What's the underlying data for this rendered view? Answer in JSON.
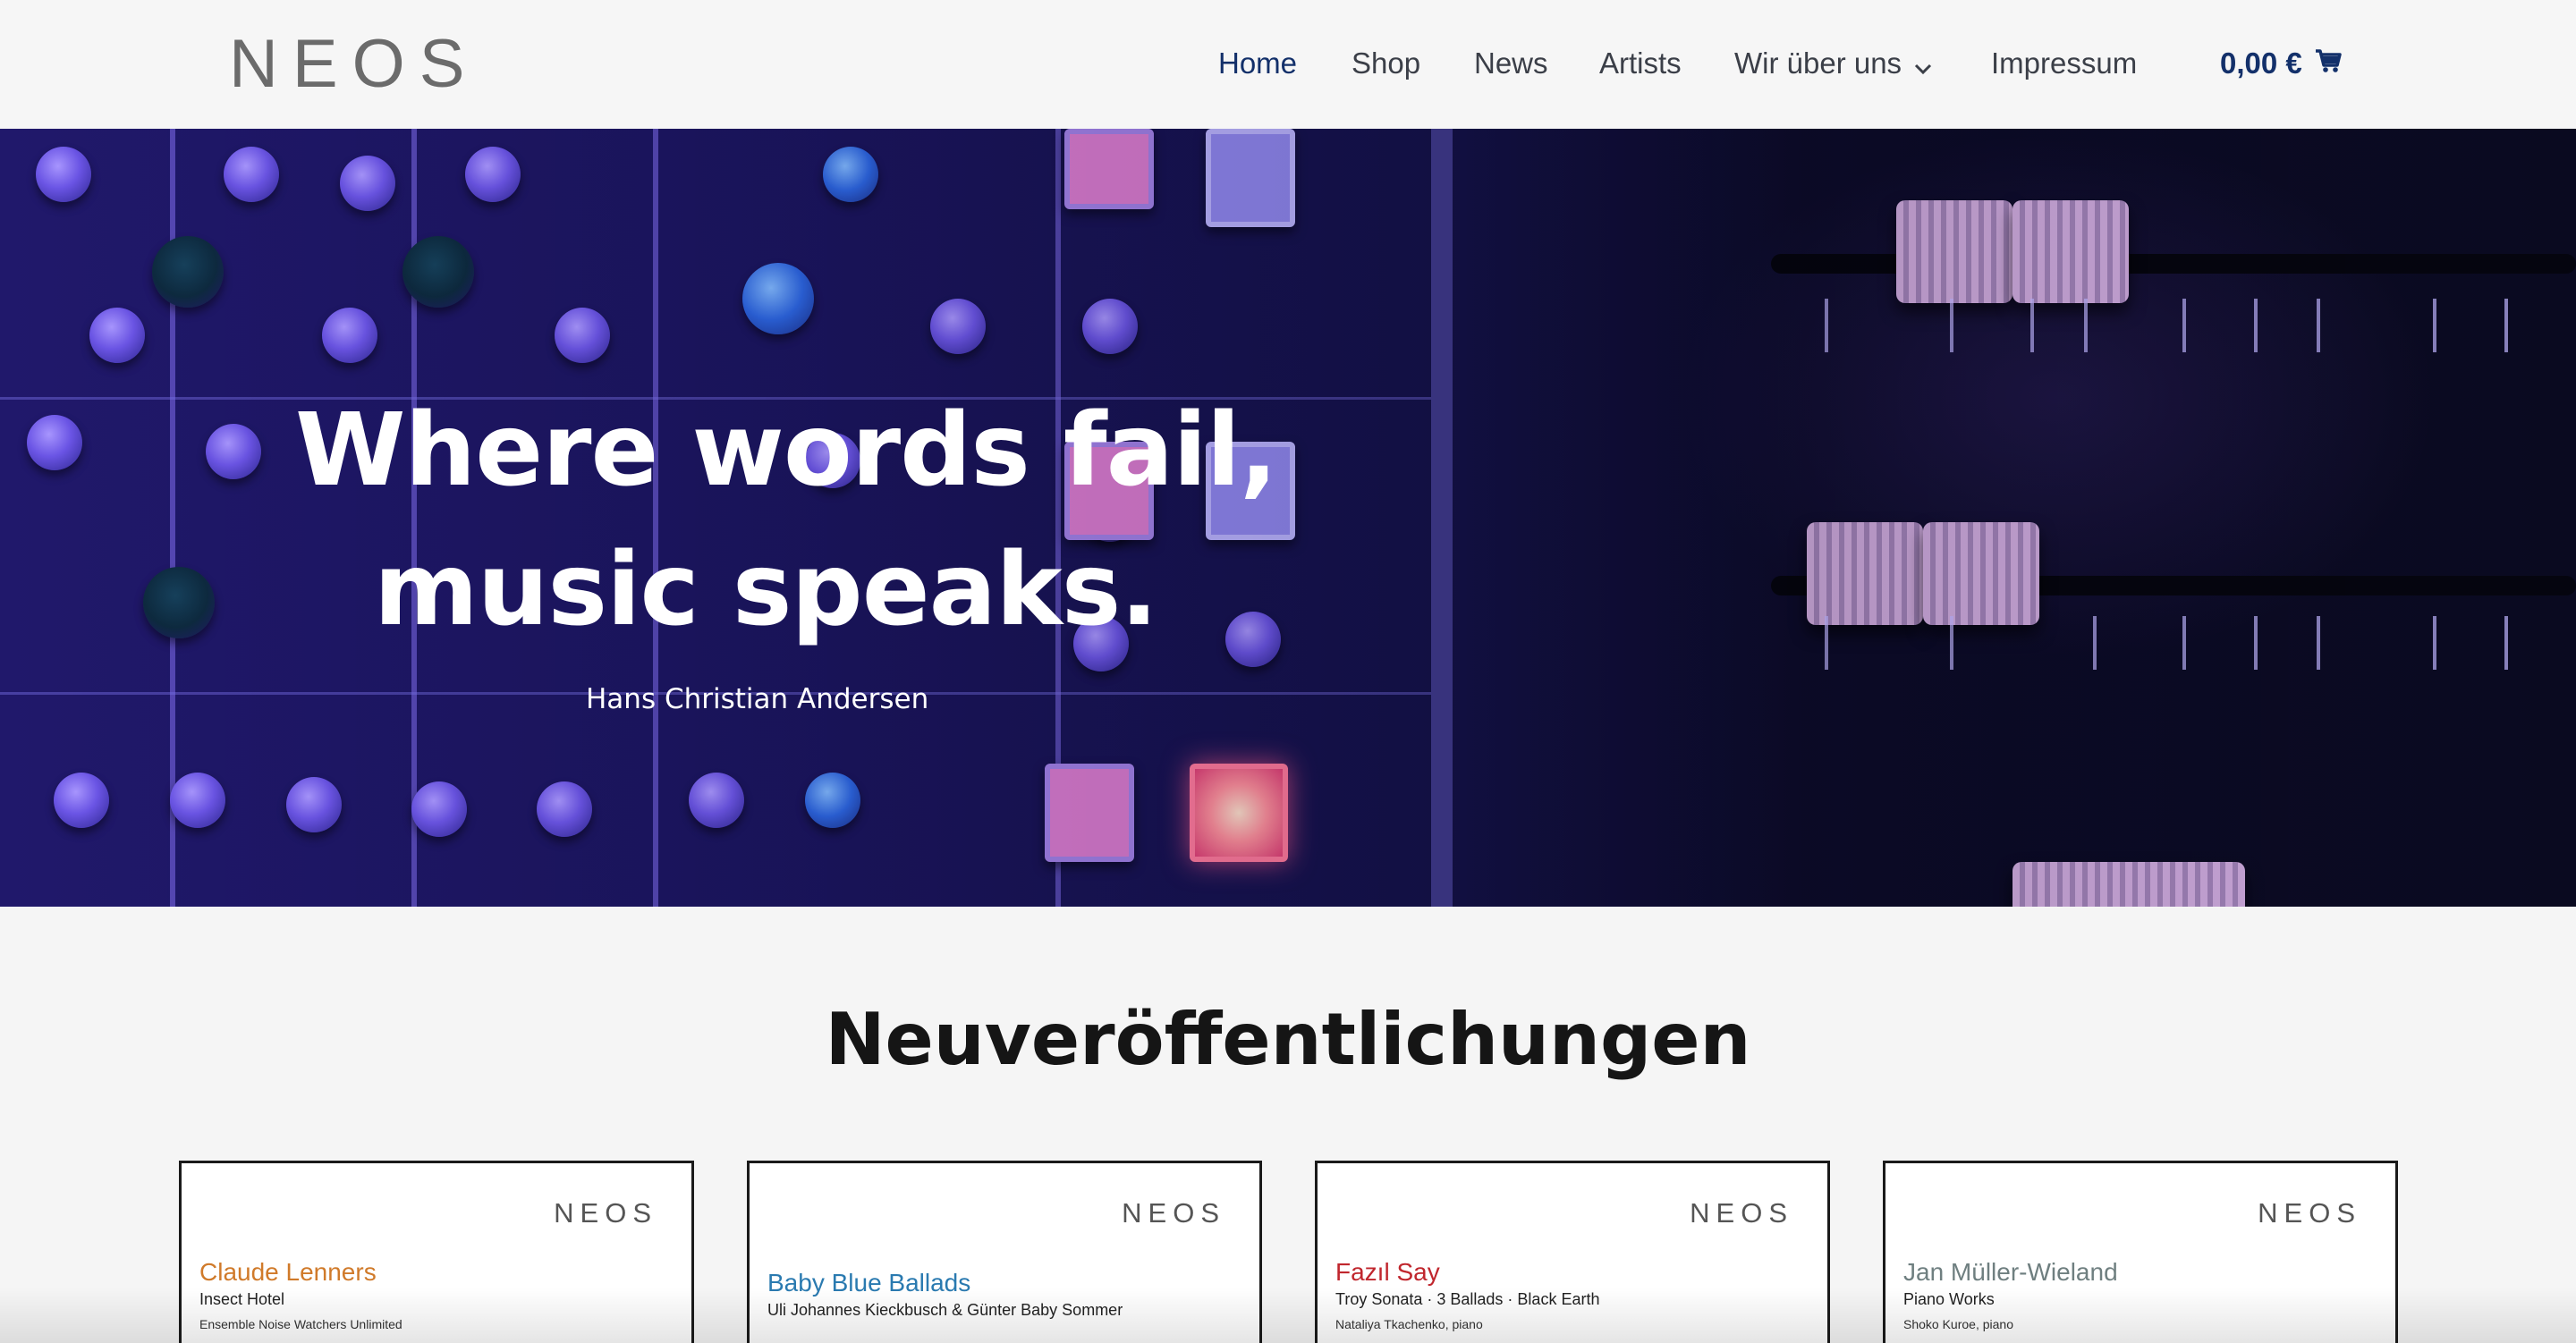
{
  "header": {
    "logo": "NEOS",
    "nav": [
      {
        "label": "Home",
        "active": true
      },
      {
        "label": "Shop",
        "active": false
      },
      {
        "label": "News",
        "active": false
      },
      {
        "label": "Artists",
        "active": false
      },
      {
        "label": "Wir über uns",
        "active": false,
        "has_dropdown": true
      },
      {
        "label": "Impressum",
        "active": false
      }
    ],
    "cart_total": "0,00 €",
    "cart_icon": "shopping-cart-icon",
    "accent_color": "#13306a"
  },
  "hero": {
    "quote_line1": "Where words fail,",
    "quote_line2": "music speaks.",
    "author": "Hans Christian Andersen",
    "background": "mixing-console-photo"
  },
  "releases": {
    "heading": "Neuveröffentlichungen",
    "cards": [
      {
        "logo": "NEOS",
        "artist": "Claude Lenners",
        "title": "Insect Hotel",
        "subtitle": "Ensemble Noise Watchers Unlimited",
        "color": "#d07a2a"
      },
      {
        "logo": "NEOS",
        "artist": "Baby Blue Ballads",
        "title": "Uli Johannes Kieckbusch & Günter Baby Sommer",
        "subtitle": "",
        "color": "#2a7ab0"
      },
      {
        "logo": "NEOS",
        "artist": "Fazıl Say",
        "title": "Troy Sonata · 3 Ballads · Black Earth",
        "subtitle": "Nataliya Tkachenko, piano",
        "color": "#c0262d"
      },
      {
        "logo": "NEOS",
        "artist": "Jan Müller-Wieland",
        "title": "Piano Works",
        "subtitle": "Shoko Kuroe, piano",
        "color": "#6f7f80"
      }
    ]
  }
}
